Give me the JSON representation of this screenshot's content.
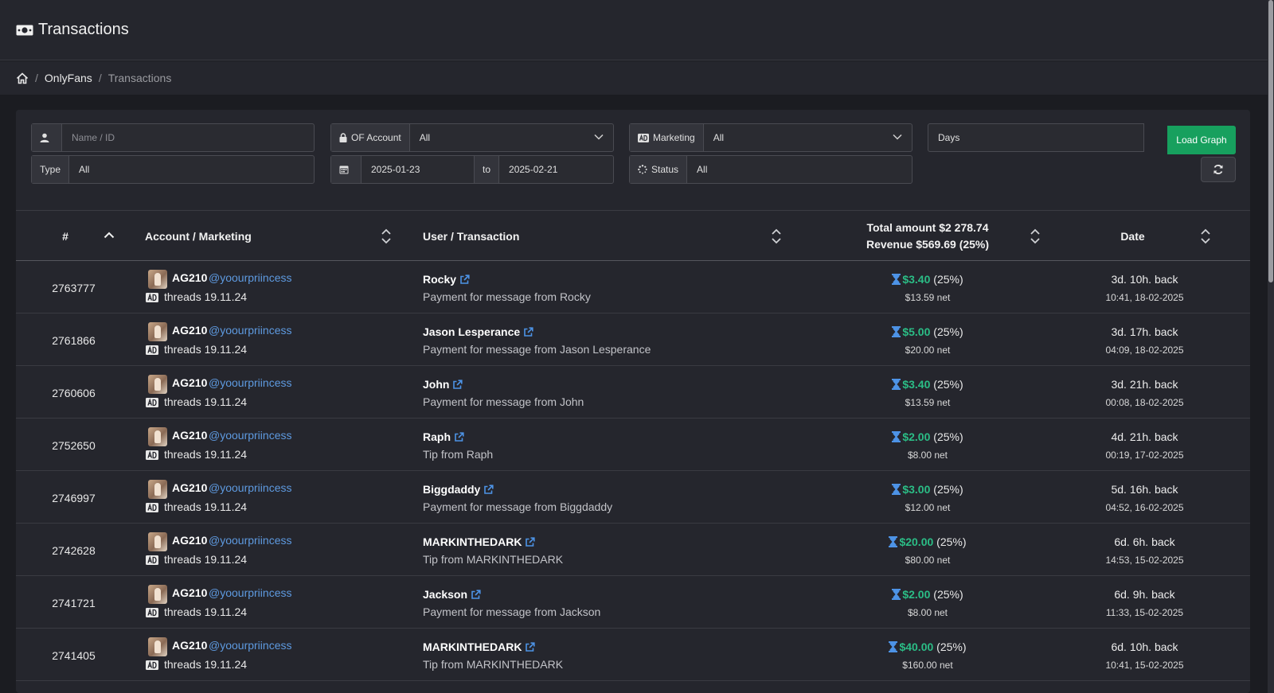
{
  "header": {
    "title": "Transactions",
    "icon": "money-icon"
  },
  "breadcrumb": {
    "home_icon": "home-icon",
    "items": [
      "OnlyFans",
      "Transactions"
    ]
  },
  "filters": {
    "name_placeholder": "Name / ID",
    "of_account_label": "OF Account",
    "of_account_value": "All",
    "marketing_label": "Marketing",
    "marketing_value": "All",
    "days_value": "Days",
    "load_graph_label": "Load Graph",
    "type_label": "Type",
    "type_value": "All",
    "date_from": "2025-01-23",
    "date_to_label": "to",
    "date_to": "2025-02-21",
    "status_label": "Status",
    "status_value": "All"
  },
  "table": {
    "columns": {
      "id": "#",
      "account": "Account / Marketing",
      "user": "User / Transaction",
      "total_line1": "Total amount $2 278.74",
      "total_line2": "Revenue $569.69 (25%)",
      "date": "Date"
    },
    "rows": [
      {
        "id": "2763777",
        "account": "AG210",
        "handle": "@yoourpriincess",
        "marketing": "threads 19.11.24",
        "user": "Rocky",
        "desc": "Payment for message from Rocky",
        "amount": "$3.40",
        "pct": "(25%)",
        "net": "$13.59 net",
        "ago": "3d. 10h. back",
        "ts": "10:41, 18-02-2025"
      },
      {
        "id": "2761866",
        "account": "AG210",
        "handle": "@yoourpriincess",
        "marketing": "threads 19.11.24",
        "user": "Jason Lesperance",
        "desc": "Payment for message from Jason Lesperance",
        "amount": "$5.00",
        "pct": "(25%)",
        "net": "$20.00 net",
        "ago": "3d. 17h. back",
        "ts": "04:09, 18-02-2025"
      },
      {
        "id": "2760606",
        "account": "AG210",
        "handle": "@yoourpriincess",
        "marketing": "threads 19.11.24",
        "user": "John",
        "desc": "Payment for message from John",
        "amount": "$3.40",
        "pct": "(25%)",
        "net": "$13.59 net",
        "ago": "3d. 21h. back",
        "ts": "00:08, 18-02-2025"
      },
      {
        "id": "2752650",
        "account": "AG210",
        "handle": "@yoourpriincess",
        "marketing": "threads 19.11.24",
        "user": "Raph",
        "desc": "Tip from Raph",
        "amount": "$2.00",
        "pct": "(25%)",
        "net": "$8.00 net",
        "ago": "4d. 21h. back",
        "ts": "00:19, 17-02-2025"
      },
      {
        "id": "2746997",
        "account": "AG210",
        "handle": "@yoourpriincess",
        "marketing": "threads 19.11.24",
        "user": "Biggdaddy",
        "desc": "Payment for message from Biggdaddy",
        "amount": "$3.00",
        "pct": "(25%)",
        "net": "$12.00 net",
        "ago": "5d. 16h. back",
        "ts": "04:52, 16-02-2025"
      },
      {
        "id": "2742628",
        "account": "AG210",
        "handle": "@yoourpriincess",
        "marketing": "threads 19.11.24",
        "user": "MARKINTHEDARK",
        "desc": "Tip from MARKINTHEDARK",
        "amount": "$20.00",
        "pct": "(25%)",
        "net": "$80.00 net",
        "ago": "6d. 6h. back",
        "ts": "14:53, 15-02-2025"
      },
      {
        "id": "2741721",
        "account": "AG210",
        "handle": "@yoourpriincess",
        "marketing": "threads 19.11.24",
        "user": "Jackson",
        "desc": "Payment for message from Jackson",
        "amount": "$2.00",
        "pct": "(25%)",
        "net": "$8.00 net",
        "ago": "6d. 9h. back",
        "ts": "11:33, 15-02-2025"
      },
      {
        "id": "2741405",
        "account": "AG210",
        "handle": "@yoourpriincess",
        "marketing": "threads 19.11.24",
        "user": "MARKINTHEDARK",
        "desc": "Tip from MARKINTHEDARK",
        "amount": "$40.00",
        "pct": "(25%)",
        "net": "$160.00 net",
        "ago": "6d. 10h. back",
        "ts": "10:41, 15-02-2025"
      }
    ]
  },
  "colors": {
    "accent_green": "#17a05e",
    "amount_green": "#2bbd86",
    "link_blue": "#5e9ae0",
    "background": "#1b1c21",
    "panel": "#25262d"
  }
}
